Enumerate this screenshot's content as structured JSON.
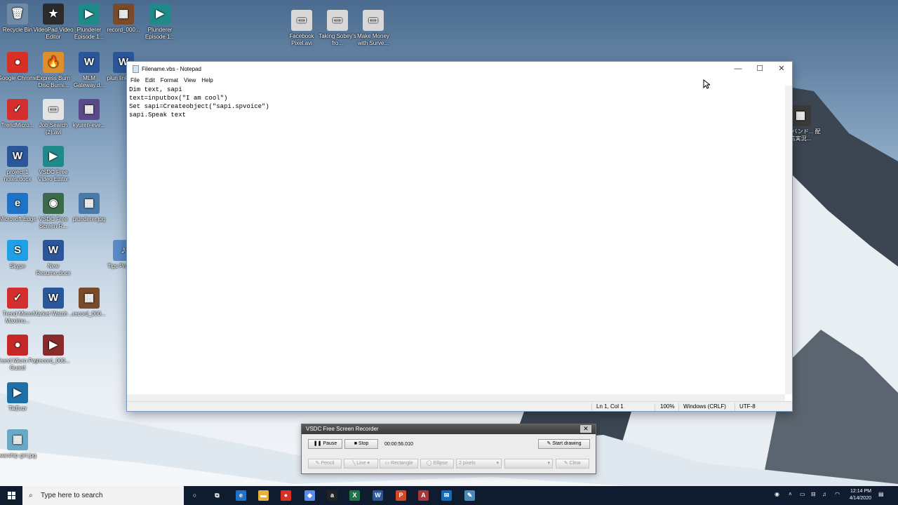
{
  "desktop": {
    "icons": [
      {
        "label": "Recycle Bin",
        "glyph": "🗑",
        "color": "#6f8aa6"
      },
      {
        "label": "VideoPad Video Editor",
        "glyph": "★",
        "color": "#2b2b2b"
      },
      {
        "label": "Plunderer Episode 1...",
        "glyph": "▶",
        "color": "#1f8a8a"
      },
      {
        "label": "record_000...",
        "glyph": "▦",
        "color": "#7a4b2a"
      },
      {
        "label": "Plunderer Episode 1...",
        "glyph": "▶",
        "color": "#1f8a8a"
      },
      {
        "label": "Facebook Pixel.avi",
        "glyph": "▭",
        "color": "#d8d8d8"
      },
      {
        "label": "Taking Sobey's fro...",
        "glyph": "▭",
        "color": "#d8d8d8"
      },
      {
        "label": "Make Money with Surve...",
        "glyph": "▭",
        "color": "#d8d8d8"
      },
      {
        "label": "Google Chrome",
        "glyph": "●",
        "color": "#d93025"
      },
      {
        "label": "Express Burn Disc Burni...",
        "glyph": "🔥",
        "color": "#e0902a"
      },
      {
        "label": "MLM Gateway.d...",
        "glyph": "W",
        "color": "#2b579a"
      },
      {
        "label": "plun links.d...",
        "glyph": "W",
        "color": "#2b579a"
      },
      {
        "label": "TrendMicro...",
        "glyph": "✓",
        "color": "#d32f2f"
      },
      {
        "label": "Job Search (2).avi",
        "glyph": "▭",
        "color": "#e4e4e4"
      },
      {
        "label": "kyuren-eve...",
        "glyph": "▦",
        "color": "#5a4a8a"
      },
      {
        "label": "project 1 notes.docx",
        "glyph": "W",
        "color": "#2b579a"
      },
      {
        "label": "VSDC Free Video Editor",
        "glyph": "▶",
        "color": "#1f8a8a"
      },
      {
        "label": "Microsoft Edge",
        "glyph": "e",
        "color": "#1e73c8"
      },
      {
        "label": "VSDC Free Screen R...",
        "glyph": "◉",
        "color": "#3a6a4a"
      },
      {
        "label": "plunderer.jpg",
        "glyph": "▦",
        "color": "#4a7aaa"
      },
      {
        "label": "Skype",
        "glyph": "S",
        "color": "#1fa0e6"
      },
      {
        "label": "New Resume.docx",
        "glyph": "W",
        "color": "#2b579a"
      },
      {
        "label": "Tips Privac...",
        "glyph": "♪",
        "color": "#5a8ac8"
      },
      {
        "label": "Trend Micro Maximu...",
        "glyph": "✓",
        "color": "#d32f2f"
      },
      {
        "label": "Market Watch ...",
        "glyph": "W",
        "color": "#2b579a"
      },
      {
        "label": "record_000...",
        "glyph": "▦",
        "color": "#7a4b2a"
      },
      {
        "label": "Trend Micro Pay Guard",
        "glyph": "●",
        "color": "#c62828"
      },
      {
        "label": "record_000...",
        "glyph": "▶",
        "color": "#8a2a2a"
      },
      {
        "label": "TikEvzr",
        "glyph": "▶",
        "color": "#1f6fa8"
      },
      {
        "label": "warship girl.jpg",
        "glyph": "▦",
        "color": "#6aa8c8"
      },
      {
        "label": "悪魔バンド... 配信実況...",
        "glyph": "▦",
        "color": "#3a3a3a"
      }
    ]
  },
  "notepad": {
    "title": "Filename.vbs - Notepad",
    "menu": [
      "File",
      "Edit",
      "Format",
      "View",
      "Help"
    ],
    "lines": [
      "Dim text, sapi",
      "text=inputbox(\"I am cool\")",
      "Set sapi=Createobject(\"sapi.spvoice\")",
      "sapi.Speak text"
    ],
    "status": {
      "position": "Ln 1, Col 1",
      "zoom": "100%",
      "line_ending": "Windows (CRLF)",
      "encoding": "UTF-8"
    },
    "controls": {
      "minimize": "—",
      "maximize": "☐",
      "close": "✕"
    }
  },
  "recorder": {
    "title": "VSDC Free Screen Recorder",
    "close": "✕",
    "pause_label": "Pause",
    "stop_label": "Stop",
    "elapsed": "00:00:56.010",
    "start_drawing_label": "Start drawing",
    "tools": {
      "pencil": "Pencil",
      "line": "Line",
      "rectangle": "Rectangle",
      "ellipse": "Ellipse",
      "thickness": "2 pixels",
      "clear": "Clear"
    }
  },
  "taskbar": {
    "search_placeholder": "Type here to search",
    "clock_time": "12:14 PM",
    "clock_date": "4/14/2020",
    "apps": [
      {
        "name": "cortana-icon",
        "glyph": "○",
        "color": "transparent"
      },
      {
        "name": "task-view-icon",
        "glyph": "⧉",
        "color": "transparent"
      },
      {
        "name": "edge-icon",
        "glyph": "e",
        "color": "#1e73c8"
      },
      {
        "name": "file-explorer-icon",
        "glyph": "▬",
        "color": "#e6b23a"
      },
      {
        "name": "chrome-icon",
        "glyph": "●",
        "color": "#d93025"
      },
      {
        "name": "dropbox-icon",
        "glyph": "◆",
        "color": "#5a8de8"
      },
      {
        "name": "amazon-icon",
        "glyph": "a",
        "color": "#222222"
      },
      {
        "name": "excel-icon",
        "glyph": "X",
        "color": "#217346"
      },
      {
        "name": "word-icon",
        "glyph": "W",
        "color": "#2b579a"
      },
      {
        "name": "powerpoint-icon",
        "glyph": "P",
        "color": "#d24726"
      },
      {
        "name": "access-icon",
        "glyph": "A",
        "color": "#a4373a"
      },
      {
        "name": "mail-icon",
        "glyph": "✉",
        "color": "#0f6cbd"
      },
      {
        "name": "notepad-icon",
        "glyph": "✎",
        "color": "#4a8ab8"
      }
    ]
  }
}
